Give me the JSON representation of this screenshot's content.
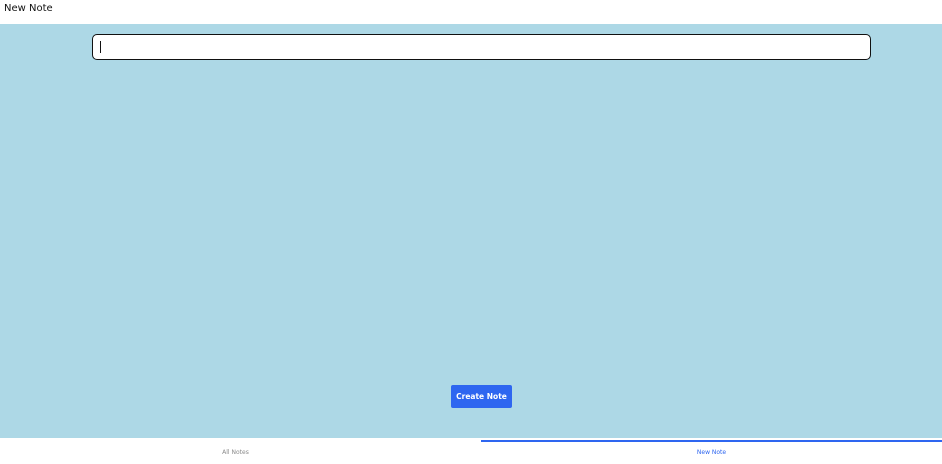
{
  "header": {
    "title": "New Note"
  },
  "editor": {
    "input_value": "",
    "placeholder": ""
  },
  "actions": {
    "create_label": "Create Note"
  },
  "tabs": [
    {
      "label": "All Notes",
      "active": false
    },
    {
      "label": "New Note",
      "active": true
    }
  ],
  "colors": {
    "background": "#add8e6",
    "accent": "#2e66f0",
    "inactive_tab_text": "#8a8a8a"
  }
}
